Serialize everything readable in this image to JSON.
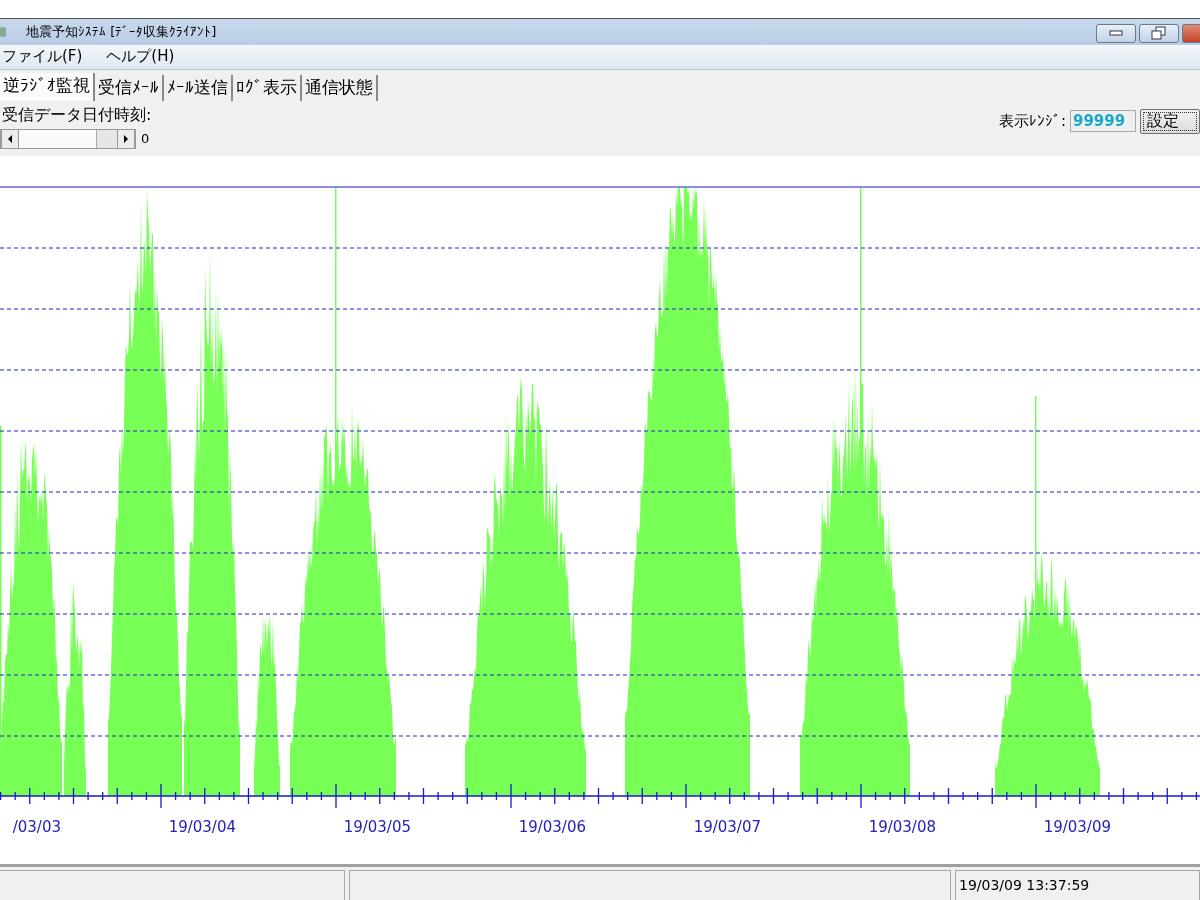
{
  "window": {
    "title": "地震予知ｼｽﾃﾑ [ﾃﾞｰﾀ収集ｸﾗｲｱﾝﾄ]"
  },
  "menu": [
    "ファイル(F)",
    "ヘルプ(H)"
  ],
  "tabs": [
    {
      "label": "逆ﾗｼﾞｵ監視",
      "selected": true
    },
    {
      "label": "受信ﾒｰﾙ",
      "selected": false
    },
    {
      "label": "ﾒｰﾙ送信",
      "selected": false
    },
    {
      "label": "ﾛｸﾞ表示",
      "selected": false
    },
    {
      "label": "通信状態",
      "selected": false
    }
  ],
  "date_label": "受信データ日付時刻:",
  "scroll_value": "0",
  "range": {
    "label": "表示ﾚﾝｼﾞ:",
    "value": "99999",
    "button": "設定"
  },
  "chart": {
    "x_labels": [
      "/03/03",
      "19/03/04",
      "19/03/05",
      "19/03/06",
      "19/03/07",
      "19/03/08",
      "19/03/09"
    ]
  },
  "status_bar": {
    "time": "19/03/09 13:37:59"
  }
}
